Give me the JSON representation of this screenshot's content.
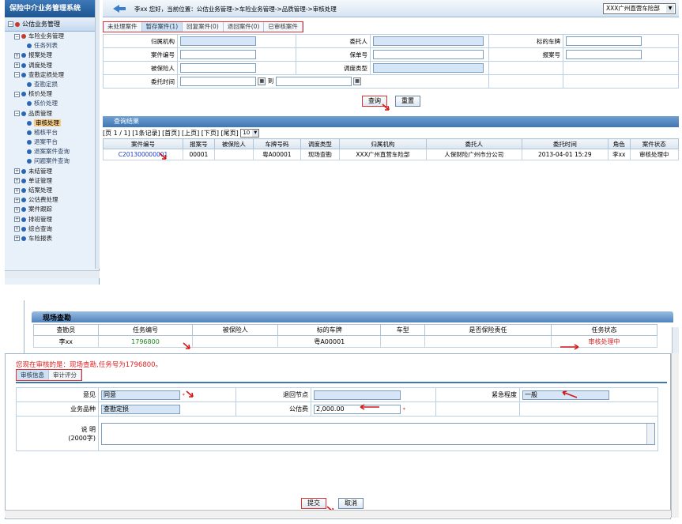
{
  "app": {
    "system_title": "保险中介业务管理系统",
    "breadcrumb": "李xx 您好，当前位置：公估业务管理->车险业务管理->品质管理->审核处理",
    "location_select": "XXX广州直营车险部"
  },
  "sidebar": {
    "top": "公估业务管理",
    "items": [
      {
        "label": "车险业务管理"
      },
      {
        "label": "任务列表"
      },
      {
        "label": "报案处理"
      },
      {
        "label": "调度处理"
      },
      {
        "label": "查勘定损处理"
      },
      {
        "label": "查勘定损"
      },
      {
        "label": "核价处理"
      },
      {
        "label": "核价处理"
      },
      {
        "label": "品质管理"
      },
      {
        "label": "审核处理"
      },
      {
        "label": "稽核平台"
      },
      {
        "label": "退案平台"
      },
      {
        "label": "退案案件查询"
      },
      {
        "label": "问题案件查询"
      },
      {
        "label": "未结管理"
      },
      {
        "label": "单证管理"
      },
      {
        "label": "结案处理"
      },
      {
        "label": "公估费处理"
      },
      {
        "label": "案件跟踪"
      },
      {
        "label": "排班管理"
      },
      {
        "label": "综合查询"
      },
      {
        "label": "车险报表"
      }
    ]
  },
  "tabs": [
    "未处理案件",
    "暂存案件(1)",
    "回复案件(0)",
    "退回案件(0)",
    "已审核案件"
  ],
  "filters": {
    "org_label": "归属机构",
    "client_label": "委托人",
    "plate_label": "标的车牌",
    "case_no_label": "案件编号",
    "policy_label": "保单号",
    "report_no_label": "报案号",
    "insured_label": "被保险人",
    "dispatch_label": "调度类型",
    "time_label": "委托时间",
    "to_label": "到"
  },
  "buttons": {
    "query": "查询",
    "reset": "重置",
    "submit": "提交",
    "cancel": "取消"
  },
  "results": {
    "bar_title": "查询结果",
    "pager": "[页 1 / 1] [1条记录] [首页] [上页] [下页] [尾页]",
    "page_size": "10",
    "columns": [
      "案件编号",
      "报案号",
      "被保险人",
      "车牌号码",
      "调度类型",
      "归属机构",
      "委托人",
      "委托时间",
      "角色",
      "案件状态"
    ],
    "rows": [
      [
        "C201300000001",
        "00001",
        "",
        "粤A00001",
        "现场查勘",
        "XXX广州直营车险部",
        "人保财险广州市分公司",
        "2013-04-01 15:29",
        "李xx",
        "审核处理中"
      ]
    ]
  },
  "survey": {
    "title": "现场查勘",
    "columns": [
      "查勘员",
      "任务编号",
      "被保险人",
      "标的车牌",
      "车型",
      "是否保险责任",
      "任务状态"
    ],
    "row": [
      "李xx",
      "1796800",
      "",
      "粤A00001",
      "",
      "",
      "审核处理中"
    ]
  },
  "review": {
    "title": "您现在审核的是：现场查勘,任务号为1796800。",
    "tabs": [
      "审核信息",
      "审计评分"
    ],
    "opinion_label": "意见",
    "opinion_value": "同意",
    "return_node_label": "退回节点",
    "return_node_value": "",
    "urgency_label": "紧急程度",
    "urgency_value": "一般",
    "category_label": "业务品种",
    "category_value": "查勘定损",
    "fee_label": "公估费",
    "fee_value": "2,000.00",
    "note_label": "说    明",
    "note_sub": "(2000字)",
    "star": "*"
  },
  "colors": {
    "accent": "#3f76b4",
    "alert": "#d22222",
    "link": "#1a3cc8",
    "success": "#1a8a1a"
  }
}
